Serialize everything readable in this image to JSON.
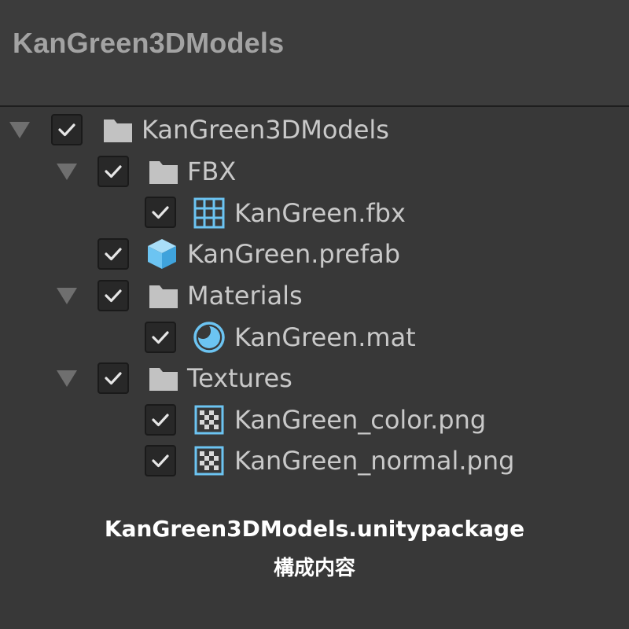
{
  "header": {
    "title": "KanGreen3DModels"
  },
  "tree": {
    "items": [
      {
        "label": "KanGreen3DModels",
        "icon": "folder-icon",
        "checked": true,
        "expanded": true
      },
      {
        "label": "FBX",
        "icon": "folder-icon",
        "checked": true,
        "expanded": true
      },
      {
        "label": "KanGreen.fbx",
        "icon": "mesh-grid-icon",
        "checked": true
      },
      {
        "label": "KanGreen.prefab",
        "icon": "prefab-cube-icon",
        "checked": true
      },
      {
        "label": "Materials",
        "icon": "folder-icon",
        "checked": true,
        "expanded": true
      },
      {
        "label": "KanGreen.mat",
        "icon": "material-sphere-icon",
        "checked": true
      },
      {
        "label": "Textures",
        "icon": "folder-icon",
        "checked": true,
        "expanded": true
      },
      {
        "label": "KanGreen_color.png",
        "icon": "texture-checker-icon",
        "checked": true
      },
      {
        "label": "KanGreen_normal.png",
        "icon": "texture-checker-icon",
        "checked": true
      }
    ]
  },
  "caption": {
    "line1": "KanGreen3DModels.unitypackage",
    "line2": "構成内容"
  },
  "colors": {
    "icon_accent": "#6cc4f2",
    "folder": "#c2c2c2",
    "text": "#c9c9c9"
  }
}
